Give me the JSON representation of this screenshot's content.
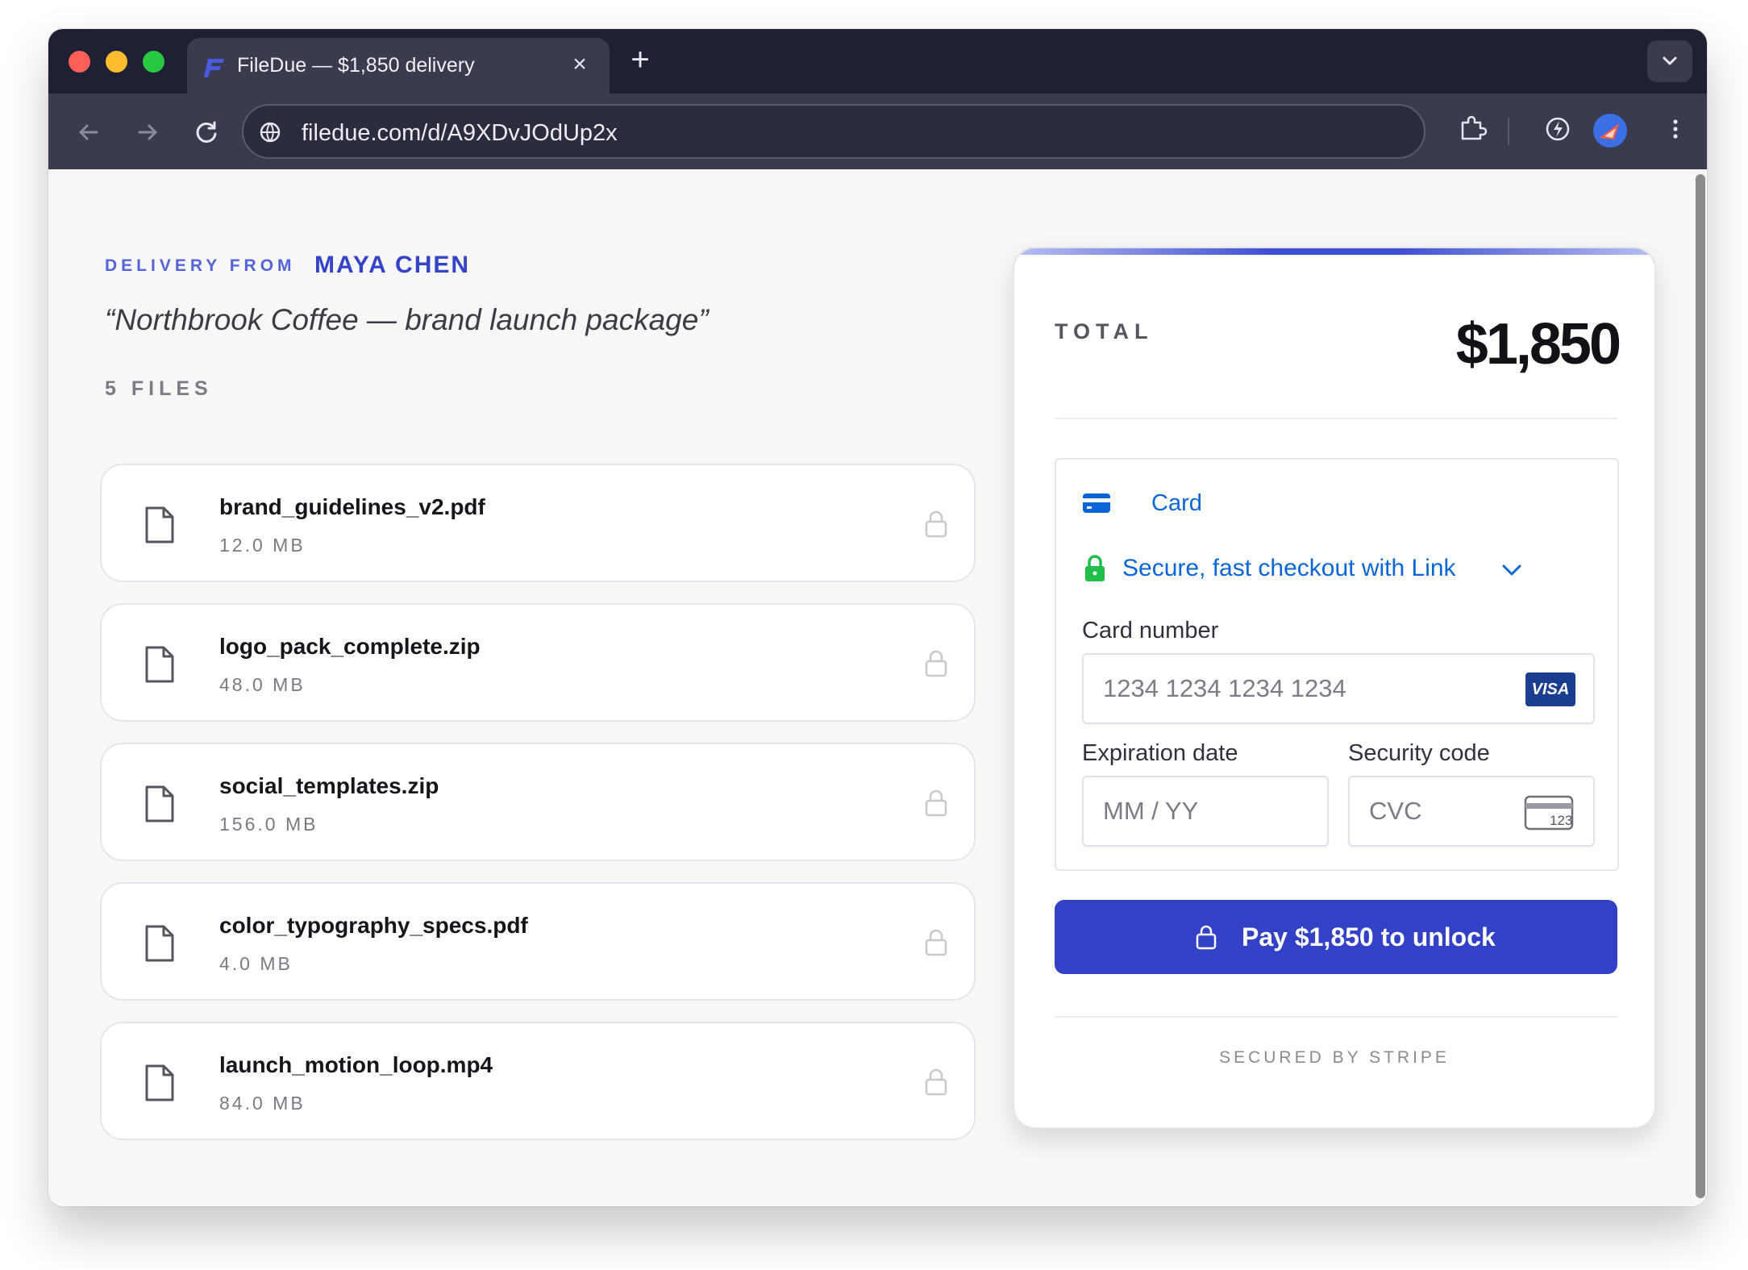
{
  "browser": {
    "tab_title": "FileDue — $1,850 delivery",
    "tab_close": "×",
    "new_tab": "+",
    "url": "filedue.com/d/A9XDvJOdUp2x"
  },
  "delivery": {
    "from_label": "DELIVERY FROM",
    "sender": "MAYA CHEN",
    "project": "“Northbrook Coffee — brand launch package”",
    "files_count": "5 FILES",
    "files": [
      {
        "name": "brand_guidelines_v2.pdf",
        "size": "12.0 MB"
      },
      {
        "name": "logo_pack_complete.zip",
        "size": "48.0 MB"
      },
      {
        "name": "social_templates.zip",
        "size": "156.0 MB"
      },
      {
        "name": "color_typography_specs.pdf",
        "size": "4.0 MB"
      },
      {
        "name": "launch_motion_loop.mp4",
        "size": "84.0 MB"
      }
    ]
  },
  "payment": {
    "total_label": "TOTAL",
    "total_amount": "$1,850",
    "method_tab": "Card",
    "link_text": "Secure, fast checkout with Link",
    "card_number_label": "Card number",
    "card_number_placeholder": "1234 1234 1234 1234",
    "card_brand": "VISA",
    "expiry_label": "Expiration date",
    "expiry_placeholder": "MM / YY",
    "cvc_label": "Security code",
    "cvc_placeholder": "CVC",
    "cvc_icon_text": "123",
    "pay_button": "Pay $1,850 to unlock",
    "footer": "SECURED BY STRIPE"
  },
  "colors": {
    "accent": "#3241c6",
    "link_blue": "#0a66d6",
    "secure_green": "#1fbf4a",
    "chrome_dark": "#1f2033"
  },
  "icons": [
    "file-icon",
    "lock-icon",
    "card-icon",
    "visa-logo",
    "cvc-card-icon",
    "back-arrow-icon",
    "forward-arrow-icon",
    "reload-icon",
    "site-info-icon",
    "extensions-icon",
    "performance-icon",
    "kebab-menu-icon"
  ]
}
